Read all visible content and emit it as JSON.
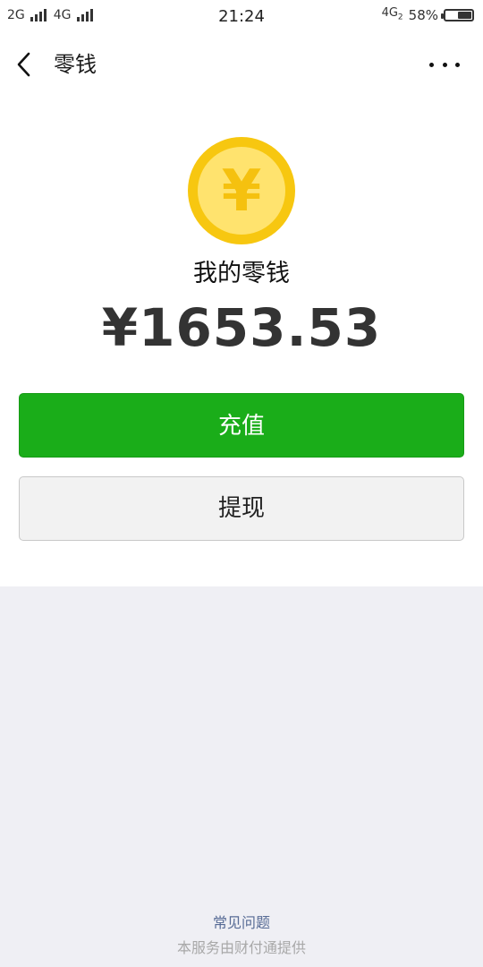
{
  "status_bar": {
    "sim1_network": "2G",
    "sim2_network": "4G",
    "time": "21:24",
    "data_network": "4G",
    "data_sub": "2",
    "battery_percent": "58%",
    "battery_level": 0.58
  },
  "nav": {
    "back_icon": "chevron-left-icon",
    "title": "零钱",
    "more_icon": "more-dots-icon"
  },
  "wallet": {
    "coin_icon": "yuan-coin-icon",
    "coin_symbol": "¥",
    "label": "我的零钱",
    "amount": "¥1653.53"
  },
  "actions": {
    "recharge_label": "充值",
    "withdraw_label": "提现"
  },
  "footer": {
    "faq_label": "常见问题",
    "provider_note": "本服务由财付通提供"
  },
  "colors": {
    "primary_green": "#1aad19",
    "coin_outer": "#f7c710",
    "coin_inner": "#ffe36e",
    "link_blue": "#576b95",
    "background_gray": "#efeff4"
  }
}
